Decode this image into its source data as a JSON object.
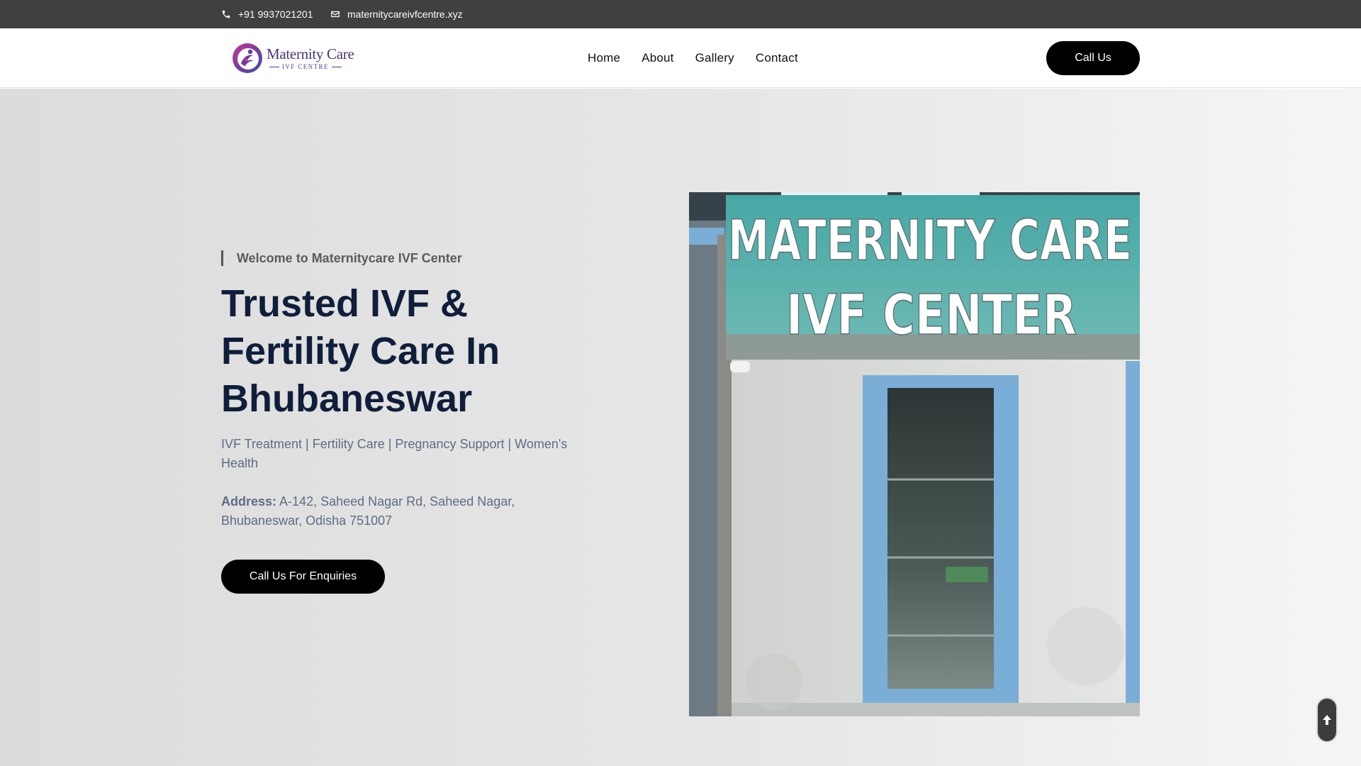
{
  "topbar": {
    "phone": "+91 9937021201",
    "email": "maternitycareivfcentre.xyz",
    "phone_icon": "phone-icon",
    "email_icon": "envelope-icon"
  },
  "header": {
    "logo": {
      "title": "Maternity Care",
      "subtitle": "IVF CENTRE",
      "icon": "mother-baby-logo-icon"
    },
    "nav": [
      {
        "label": "Home"
      },
      {
        "label": "About"
      },
      {
        "label": "Gallery"
      },
      {
        "label": "Contact"
      }
    ],
    "cta_label": "Call Us"
  },
  "hero": {
    "welcome": "Welcome to Maternitycare IVF Center",
    "headline_lines": [
      "Trusted IVF &",
      "Fertility Care In",
      "Bhubaneswar"
    ],
    "services": "IVF Treatment | Fertility Care | Pregnancy Support | Women's Health",
    "address_label": "Address:",
    "address_value": "A-142, Saheed Nagar Rd, Saheed Nagar, Bhubaneswar, Odisha 751007",
    "cta_label": "Call Us For Enquiries"
  },
  "photo": {
    "sign_line1": "MATERNITY CARE",
    "sign_line2": "IVF CENTER"
  },
  "scroll_top": {
    "icon": "arrow-up-icon"
  },
  "colors": {
    "topbar": "#404040",
    "heading": "#0f1e3a",
    "body_text": "#5e6c83",
    "button": "#000000",
    "sign": "#3fa3a0",
    "frame_blue": "#7aaed6"
  }
}
